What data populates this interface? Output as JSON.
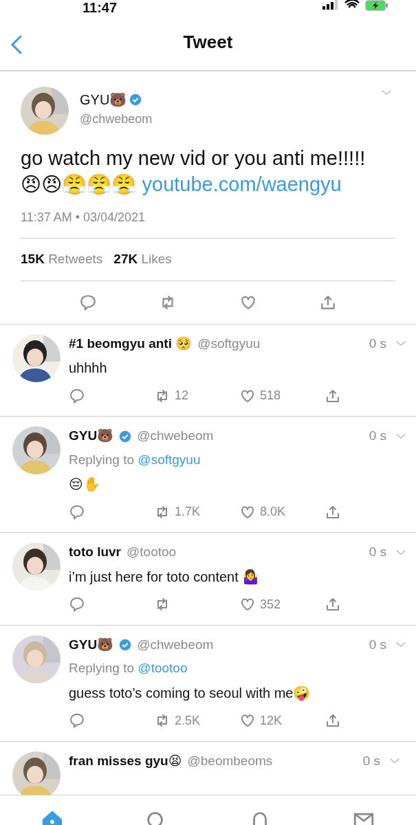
{
  "status_bar": {
    "time": "11:47"
  },
  "header": {
    "title": "Tweet"
  },
  "tweet": {
    "name": "GYU🐻",
    "verified": true,
    "handle": "@chwebeom",
    "body": "go watch my new vid or you anti me!!!!!",
    "emojis": "😠😠😤😤😤",
    "link": "youtube.com/waengyu",
    "timestamp": "11:37 AM • 03/04/2021",
    "retweets": "15K",
    "retweets_label": "Retweets",
    "likes": "27K",
    "likes_label": "Likes"
  },
  "replies": [
    {
      "name": "#1 beomgyu anti 🥺",
      "verified": false,
      "handle": "@softgyuu",
      "time": "0 s",
      "body": "uhhhh",
      "retweets": "12",
      "likes": "518"
    },
    {
      "name": "GYU🐻",
      "verified": true,
      "handle": "@chwebeom",
      "time": "0 s",
      "replying_label": "Replying to",
      "replying_to": "@softgyuu",
      "body": "😔✋",
      "retweets": "1.7K",
      "likes": "8.0K"
    },
    {
      "name": "toto luvr",
      "verified": false,
      "handle": "@tootoo",
      "time": "0 s",
      "body": "i’m just here for toto content 🤷‍♀️",
      "likes": "352"
    },
    {
      "name": "GYU🐻",
      "verified": true,
      "handle": "@chwebeom",
      "time": "0 s",
      "replying_label": "Replying to",
      "replying_to": "@tootoo",
      "body": "guess toto’s coming to seoul with me🤪",
      "retweets": "2.5K",
      "likes": "12K"
    },
    {
      "name": "fran misses gyu😫",
      "verified": false,
      "handle": "@beombeoms",
      "time": "0 s"
    }
  ],
  "tab_bar": [
    {
      "kind": "home",
      "selected": true
    },
    {
      "kind": "search",
      "selected": false
    },
    {
      "kind": "notifications",
      "selected": false
    },
    {
      "kind": "messages",
      "selected": false
    }
  ]
}
